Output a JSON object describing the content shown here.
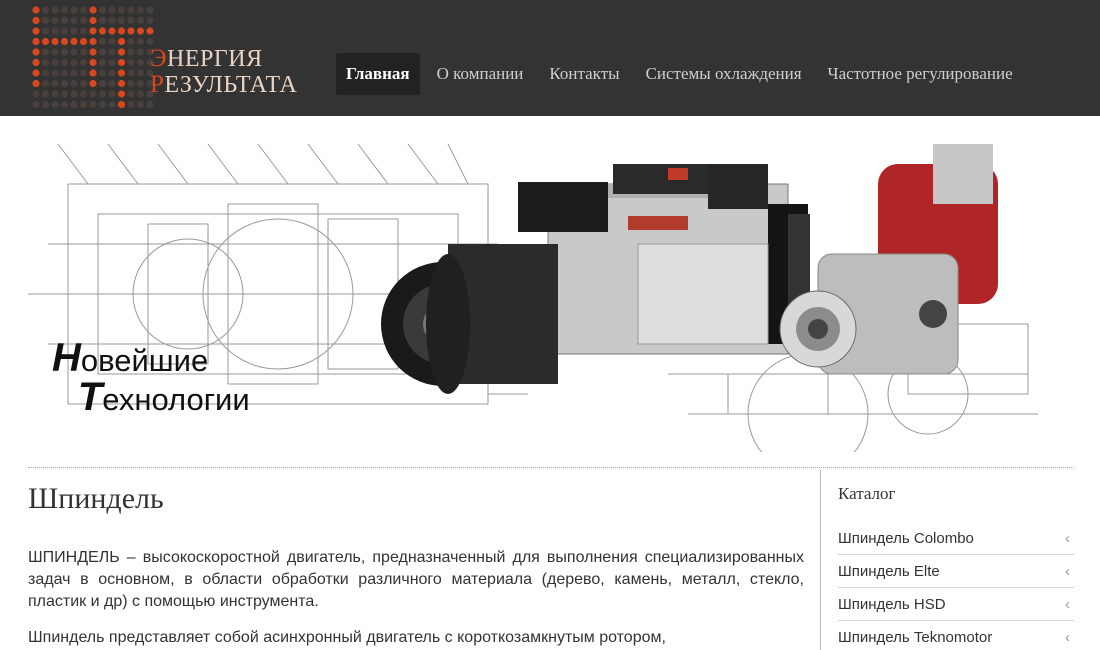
{
  "header": {
    "logo": {
      "line1_initial": "Э",
      "line1_rest": "НЕРГИЯ",
      "line2_initial": "Р",
      "line2_rest": "ЕЗУЛЬТАТА"
    },
    "nav": [
      {
        "label": "Главная",
        "active": true
      },
      {
        "label": "О компании",
        "active": false
      },
      {
        "label": "Контакты",
        "active": false
      },
      {
        "label": "Системы охлаждения",
        "active": false
      },
      {
        "label": "Частотное регулирование",
        "active": false
      }
    ]
  },
  "banner": {
    "caption_line1_initial": "Н",
    "caption_line1_rest": "овейшие",
    "caption_line2_initial": "Т",
    "caption_line2_rest": "ехнологии"
  },
  "main": {
    "title": "Шпиндель",
    "paragraphs": [
      "ШПИНДЕЛЬ – высокоскоростной двигатель, предназначенный для выполнения специализированных задач в основном, в области обработки различного материала (дерево, камень, металл, стекло, пластик и др) с помощью инструмента.",
      "Шпиндель представляет собой асинхронный двигатель с короткозамкнутым ротором,"
    ]
  },
  "sidebar": {
    "title": "Каталог",
    "items": [
      {
        "label": "Шпиндель Colombo"
      },
      {
        "label": "Шпиндель Elte"
      },
      {
        "label": "Шпиндель HSD"
      },
      {
        "label": "Шпиндель Teknomotor"
      }
    ],
    "chevron_icon": "chevron-left-icon"
  },
  "colors": {
    "header_bg": "#333333",
    "logo_accent": "#d7481f",
    "logo_text": "#e8d3c4"
  }
}
